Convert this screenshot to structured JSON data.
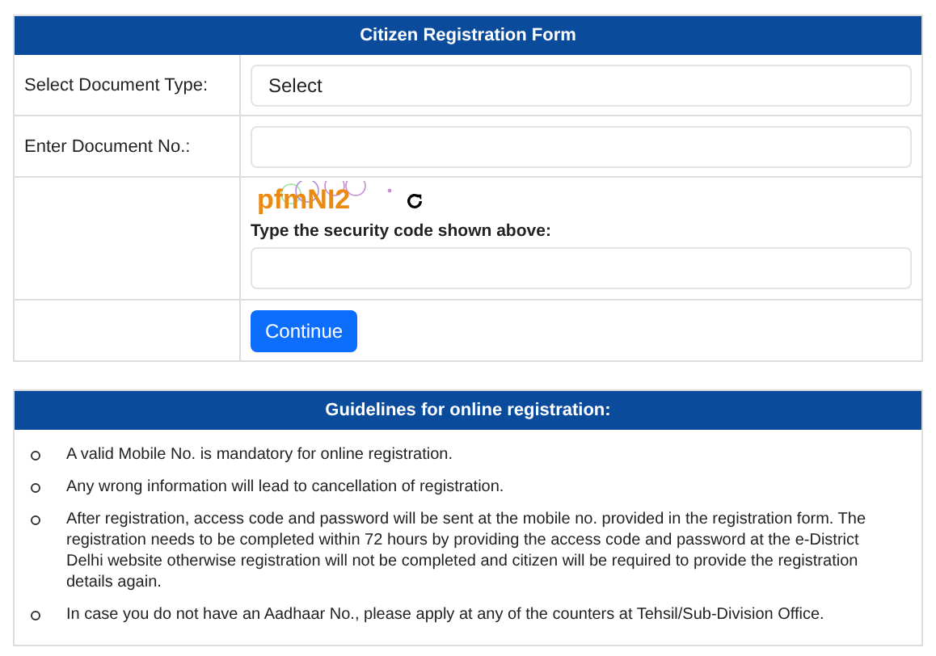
{
  "form": {
    "title": "Citizen Registration Form",
    "document_type": {
      "label": "Select Document Type:",
      "value": "Select"
    },
    "document_no": {
      "label": "Enter Document No.:"
    },
    "captcha": {
      "code": "pfmNI2",
      "label": "Type the security code shown above:"
    },
    "submit": "Continue"
  },
  "guidelines": {
    "title": "Guidelines for online registration:",
    "items": [
      "A valid Mobile No. is mandatory for online registration.",
      "Any wrong information will lead to cancellation of registration.",
      "After registration, access code and password will be sent at the mobile no. provided in the registration form. The registration needs to be completed within 72 hours by providing the access code and password at the e-District Delhi website otherwise registration will not be completed and citizen will be required to provide the registration details again.",
      "In case you do not have an Aadhaar No., please apply at any of the counters at Tehsil/Sub-Division Office."
    ]
  }
}
